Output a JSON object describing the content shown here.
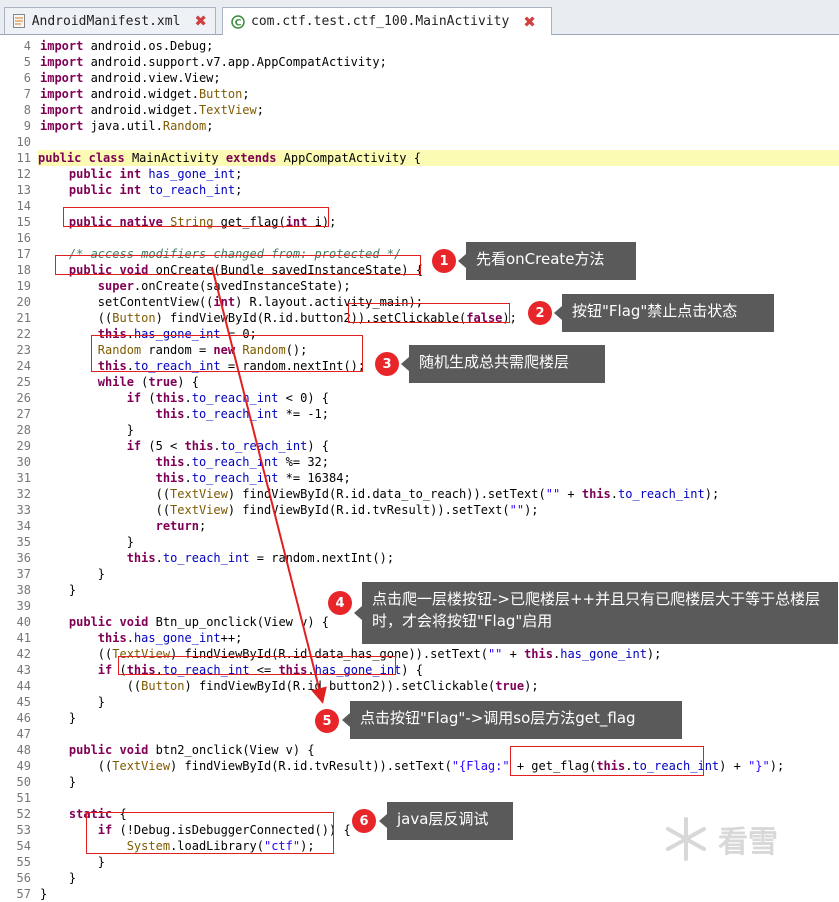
{
  "tabs": [
    {
      "label": "AndroidManifest.xml",
      "icon": "xml-file-icon",
      "active": false
    },
    {
      "label": "com.ctf.test.ctf_100.MainActivity",
      "icon": "java-class-icon",
      "active": true
    }
  ],
  "code_lines": [
    {
      "n": "4",
      "t": "import android.os.Debug;"
    },
    {
      "n": "5",
      "t": "import android.support.v7.app.AppCompatActivity;"
    },
    {
      "n": "6",
      "t": "import android.view.View;"
    },
    {
      "n": "7",
      "t": "import android.widget.Button;"
    },
    {
      "n": "8",
      "t": "import android.widget.TextView;"
    },
    {
      "n": "9",
      "t": "import java.util.Random;"
    },
    {
      "n": "10",
      "t": ""
    },
    {
      "n": "11",
      "t": "public class MainActivity extends AppCompatActivity {"
    },
    {
      "n": "12",
      "t": "    public int has_gone_int;"
    },
    {
      "n": "13",
      "t": "    public int to_reach_int;"
    },
    {
      "n": "14",
      "t": ""
    },
    {
      "n": "15",
      "t": "    public native String get_flag(int i);"
    },
    {
      "n": "16",
      "t": ""
    },
    {
      "n": "17",
      "t": "    /* access modifiers changed from: protected */"
    },
    {
      "n": "18",
      "t": "    public void onCreate(Bundle savedInstanceState) {"
    },
    {
      "n": "19",
      "t": "        super.onCreate(savedInstanceState);"
    },
    {
      "n": "20",
      "t": "        setContentView((int) R.layout.activity_main);"
    },
    {
      "n": "21",
      "t": "        ((Button) findViewById(R.id.button2)).setClickable(false);"
    },
    {
      "n": "22",
      "t": "        this.has_gone_int = 0;"
    },
    {
      "n": "23",
      "t": "        Random random = new Random();"
    },
    {
      "n": "24",
      "t": "        this.to_reach_int = random.nextInt();"
    },
    {
      "n": "25",
      "t": "        while (true) {"
    },
    {
      "n": "26",
      "t": "            if (this.to_reach_int < 0) {"
    },
    {
      "n": "27",
      "t": "                this.to_reach_int *= -1;"
    },
    {
      "n": "28",
      "t": "            }"
    },
    {
      "n": "29",
      "t": "            if (5 < this.to_reach_int) {"
    },
    {
      "n": "30",
      "t": "                this.to_reach_int %= 32;"
    },
    {
      "n": "31",
      "t": "                this.to_reach_int *= 16384;"
    },
    {
      "n": "32",
      "t": "                ((TextView) findViewById(R.id.data_to_reach)).setText(\"\" + this.to_reach_int);"
    },
    {
      "n": "33",
      "t": "                ((TextView) findViewById(R.id.tvResult)).setText(\"\");"
    },
    {
      "n": "34",
      "t": "                return;"
    },
    {
      "n": "35",
      "t": "            }"
    },
    {
      "n": "36",
      "t": "            this.to_reach_int = random.nextInt();"
    },
    {
      "n": "37",
      "t": "        }"
    },
    {
      "n": "38",
      "t": "    }"
    },
    {
      "n": "39",
      "t": ""
    },
    {
      "n": "40",
      "t": "    public void Btn_up_onclick(View v) {"
    },
    {
      "n": "41",
      "t": "        this.has_gone_int++;"
    },
    {
      "n": "42",
      "t": "        ((TextView) findViewById(R.id.data_has_gone)).setText(\"\" + this.has_gone_int);"
    },
    {
      "n": "43",
      "t": "        if (this.to_reach_int <= this.has_gone_int) {"
    },
    {
      "n": "44",
      "t": "            ((Button) findViewById(R.id.button2)).setClickable(true);"
    },
    {
      "n": "45",
      "t": "        }"
    },
    {
      "n": "46",
      "t": "    }"
    },
    {
      "n": "47",
      "t": ""
    },
    {
      "n": "48",
      "t": "    public void btn2_onclick(View v) {"
    },
    {
      "n": "49",
      "t": "        ((TextView) findViewById(R.id.tvResult)).setText(\"{Flag:\" + get_flag(this.to_reach_int) + \"}\");"
    },
    {
      "n": "50",
      "t": "    }"
    },
    {
      "n": "51",
      "t": ""
    },
    {
      "n": "52",
      "t": "    static {"
    },
    {
      "n": "53",
      "t": "        if (!Debug.isDebuggerConnected()) {"
    },
    {
      "n": "54",
      "t": "            System.loadLibrary(\"ctf\");"
    },
    {
      "n": "55",
      "t": "        }"
    },
    {
      "n": "56",
      "t": "    }"
    },
    {
      "n": "57",
      "t": "}"
    }
  ],
  "annotations": [
    {
      "num": "1",
      "text": "先看onCreate方法"
    },
    {
      "num": "2",
      "text": "按钮\"Flag\"禁止点击状态"
    },
    {
      "num": "3",
      "text": "随机生成总共需爬楼层"
    },
    {
      "num": "4",
      "text": "点击爬一层楼按钮->已爬楼层++并且只有已爬楼层大于等于总楼层时，才会将按钮\"Flag\"启用"
    },
    {
      "num": "5",
      "text": "点击按钮\"Flag\"->调用so层方法get_flag"
    },
    {
      "num": "6",
      "text": "java层反调试"
    }
  ],
  "watermark": "看雪",
  "colors": {
    "keyword": "#7f0055",
    "comment": "#3f7f5f",
    "string": "#2a00ff",
    "field": "#0000c0",
    "annotation_red": "#e8262a",
    "note_bg": "#5a5a5a",
    "highlight": "#fbfbb4"
  }
}
